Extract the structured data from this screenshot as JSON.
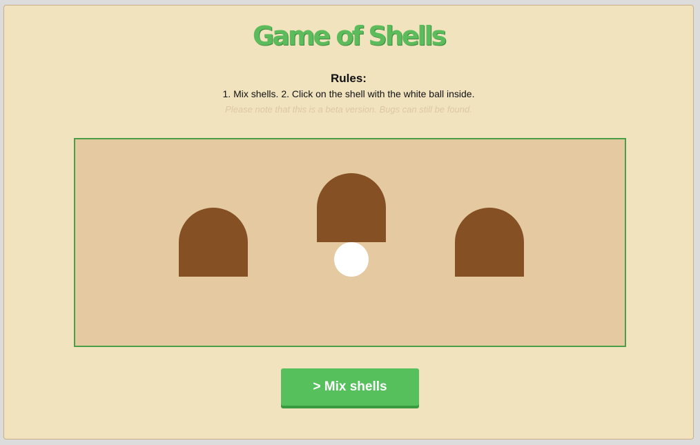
{
  "title": "Game of Shells",
  "rules": {
    "heading": "Rules:",
    "text": "1. Mix shells. 2. Click on the shell with the white ball inside.",
    "note": "Please note that this is a beta version. Bugs can still be found."
  },
  "board": {
    "shell_count": 3,
    "ball_under_shell": 2,
    "shell_lifted": 2
  },
  "mix_button": {
    "label": "> Mix shells"
  },
  "colors": {
    "background": "#f2e3bf",
    "title": "#5cbc5c",
    "board": "#e4c9a1",
    "board_border": "#4a9e45",
    "shell": "#855023",
    "ball": "#ffffff",
    "button": "#55c05c"
  }
}
